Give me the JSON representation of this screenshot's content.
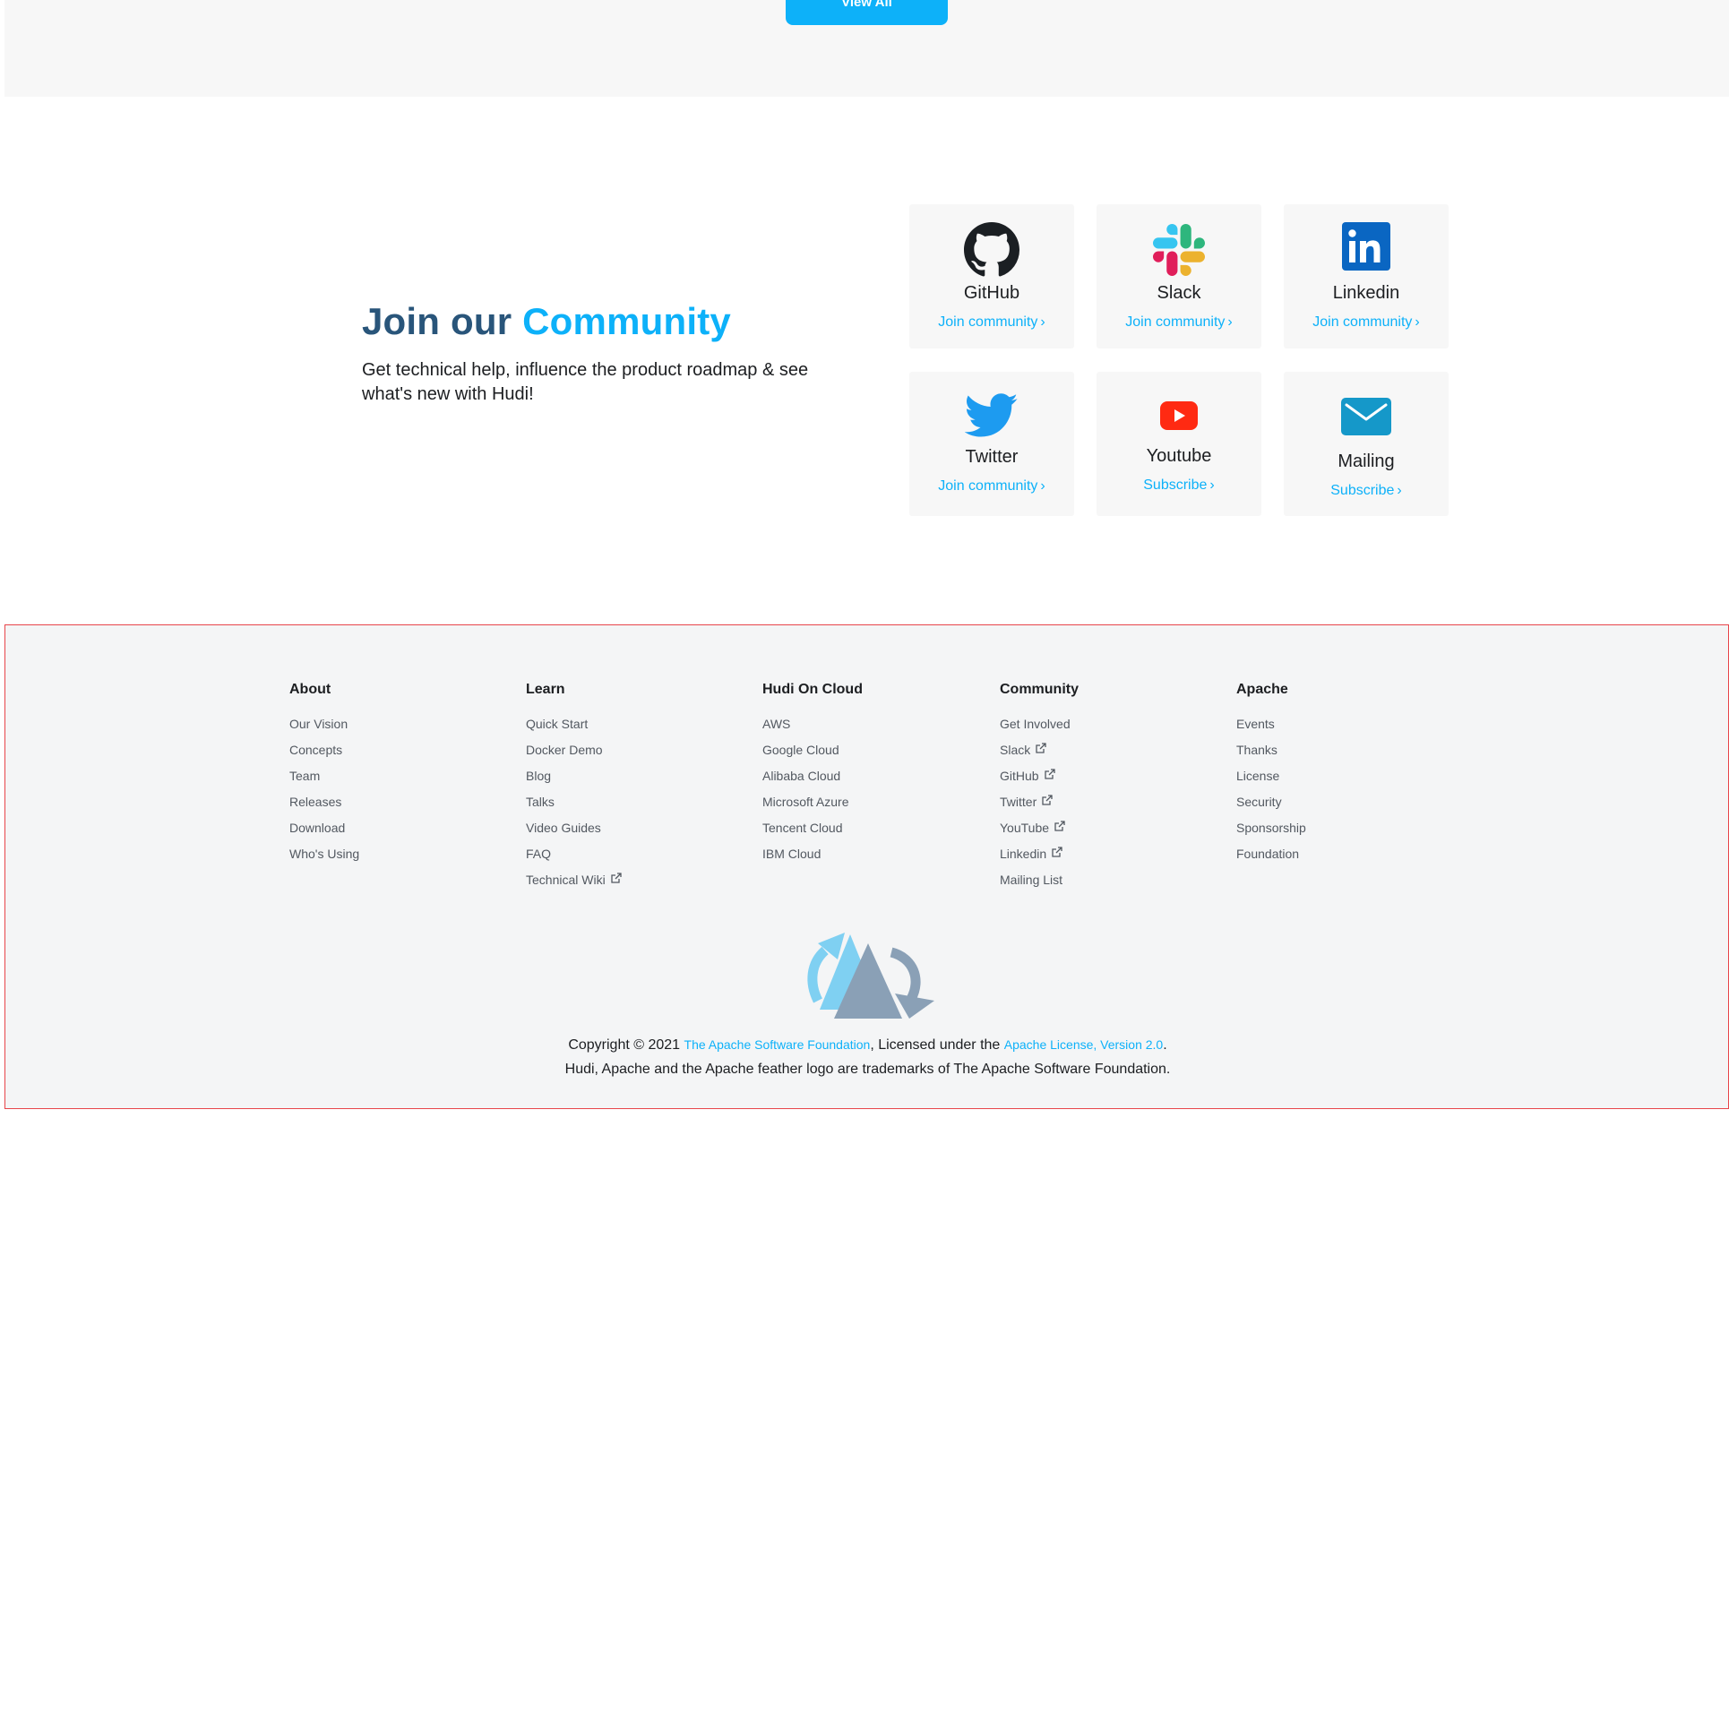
{
  "top": {
    "view_all_label": "View All"
  },
  "community": {
    "heading_prefix": "Join our",
    "heading_accent": "Community",
    "description": "Get technical help, influence the product roadmap & see what's new with Hudi!",
    "cards": [
      {
        "name": "GitHub",
        "link": "Join community",
        "icon": "github-icon"
      },
      {
        "name": "Slack",
        "link": "Join community",
        "icon": "slack-icon"
      },
      {
        "name": "Linkedin",
        "link": "Join community",
        "icon": "linkedin-icon"
      },
      {
        "name": "Twitter",
        "link": "Join community",
        "icon": "twitter-icon"
      },
      {
        "name": "Youtube",
        "link": "Subscribe",
        "icon": "youtube-icon"
      },
      {
        "name": "Mailing",
        "link": "Subscribe",
        "icon": "mail-icon"
      }
    ]
  },
  "footer": {
    "columns": [
      {
        "title": "About",
        "items": [
          "Our Vision",
          "Concepts",
          "Team",
          "Releases",
          "Download",
          "Who's Using"
        ]
      },
      {
        "title": "Learn",
        "items": [
          "Quick Start",
          "Docker Demo",
          "Blog",
          "Talks",
          "Video Guides",
          "FAQ",
          "Technical Wiki"
        ]
      },
      {
        "title": "Hudi On Cloud",
        "items": [
          "AWS",
          "Google Cloud",
          "Alibaba Cloud",
          "Microsoft Azure",
          "Tencent Cloud",
          "IBM Cloud"
        ]
      },
      {
        "title": "Community",
        "items": [
          "Get Involved",
          "Slack",
          "GitHub",
          "Twitter",
          "YouTube",
          "Linkedin",
          "Mailing List"
        ]
      },
      {
        "title": "Apache",
        "items": [
          "Events",
          "Thanks",
          "License",
          "Security",
          "Sponsorship",
          "Foundation"
        ]
      }
    ],
    "copyright_prefix": "Copyright © 2021 ",
    "asf_link": "The Apache Software Foundation",
    "licensed_text": ", Licensed under the ",
    "license_link": "Apache License, Version 2.0",
    "period": ".",
    "trademark": "Hudi, Apache and the Apache feather logo are trademarks of The Apache Software Foundation."
  },
  "colors": {
    "accent": "#0db1f9",
    "heading": "#29557a",
    "footer_border": "#e8454a"
  }
}
